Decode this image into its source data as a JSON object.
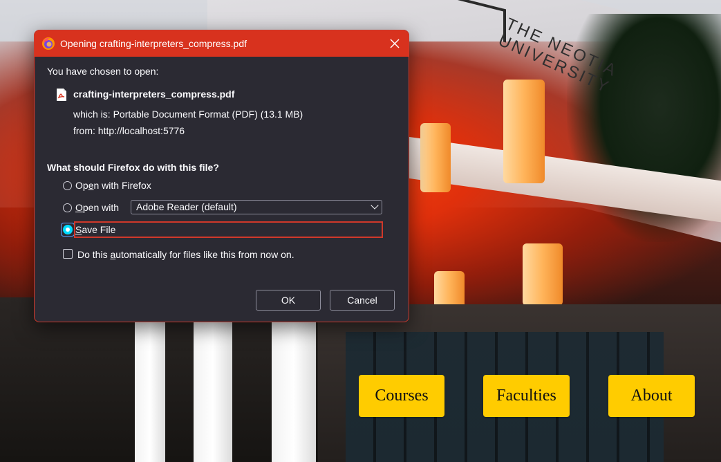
{
  "dialog": {
    "title": "Opening crafting-interpreters_compress.pdf",
    "intro": "You have chosen to open:",
    "file_name": "crafting-interpreters_compress.pdf",
    "which_is": "which is:  Portable Document Format (PDF) (13.1 MB)",
    "from": "from:  http://localhost:5776",
    "question": "What should Firefox do with this file?",
    "options": [
      {
        "pre": "Op",
        "u": "e",
        "post": "n with Firefox",
        "selected": false
      },
      {
        "pre": "",
        "u": "O",
        "post": "pen with",
        "selected": false
      },
      {
        "pre": "",
        "u": "S",
        "post": "ave File",
        "selected": true
      }
    ],
    "open_with_app": "Adobe Reader (default)",
    "auto_pre": "Do this ",
    "auto_u": "a",
    "auto_post": "utomatically for files like this from now on.",
    "auto_checked": false,
    "ok_label": "OK",
    "cancel_label": "Cancel"
  },
  "nav": {
    "items": [
      "Courses",
      "Faculties",
      "About"
    ]
  },
  "background": {
    "logo_text": "THE NEOTIA UNIVERSITY"
  },
  "colors": {
    "titlebar": "#d8321e",
    "dialog_bg": "#2b2a33",
    "nav_button": "#ffcc00",
    "radio_checked": "#00ddff"
  }
}
